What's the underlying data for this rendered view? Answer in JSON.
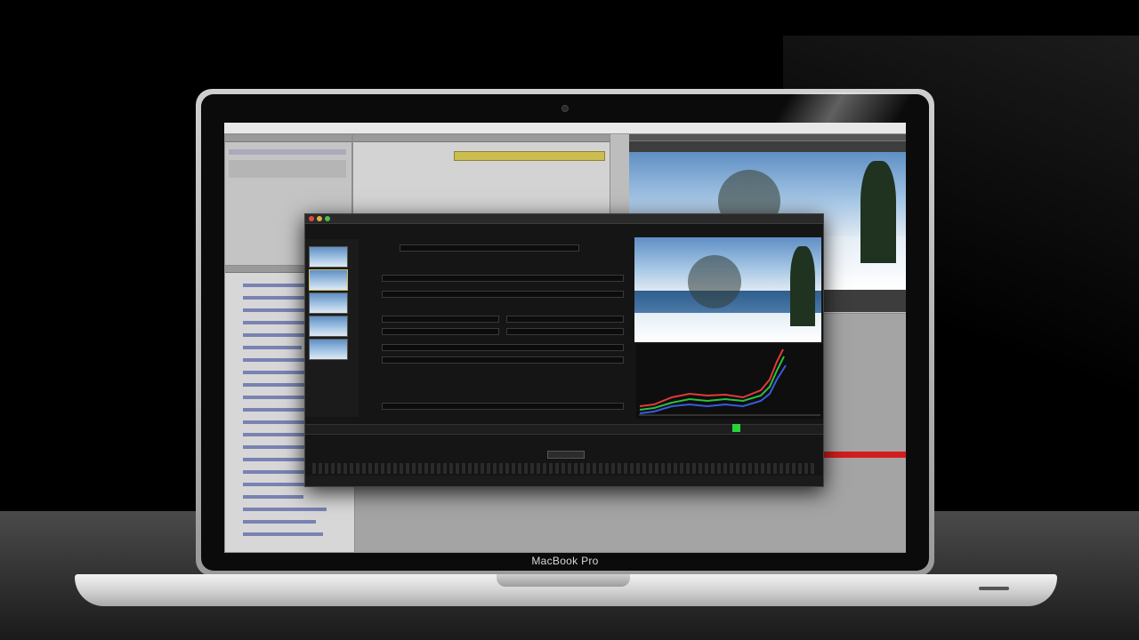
{
  "device": {
    "brand_label": "MacBook Pro"
  },
  "colors": {
    "accent_yellow": "#cbbd4f",
    "alert_red": "#d21d1d",
    "status_green": "#29d43a",
    "dialog_bg": "#151515"
  },
  "icons": {
    "close": "close-icon",
    "minimize": "minimize-icon",
    "zoom": "zoom-icon",
    "play": "play-icon"
  }
}
